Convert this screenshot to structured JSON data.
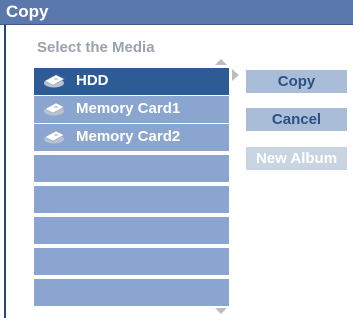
{
  "dialog": {
    "title": "Copy",
    "subtitle": "Select the Media"
  },
  "media_list": {
    "items": [
      {
        "label": "HDD",
        "icon": "hdd-disk-icon",
        "selected": true
      },
      {
        "label": "Memory Card1",
        "icon": "memory-card-icon",
        "selected": false
      },
      {
        "label": "Memory Card2",
        "icon": "memory-card-icon",
        "selected": false
      }
    ],
    "empty_rows": 5
  },
  "buttons": {
    "copy": "Copy",
    "cancel": "Cancel",
    "new_album": "New Album"
  },
  "colors": {
    "title_bar": "#5a78ab",
    "row": "#8aa5d0",
    "row_selected": "#2d5b96",
    "button": "#a9bdd9",
    "button_disabled": "#c9d4e3",
    "button_text": "#2d4f82",
    "subtitle_text": "#9aa3ad"
  }
}
